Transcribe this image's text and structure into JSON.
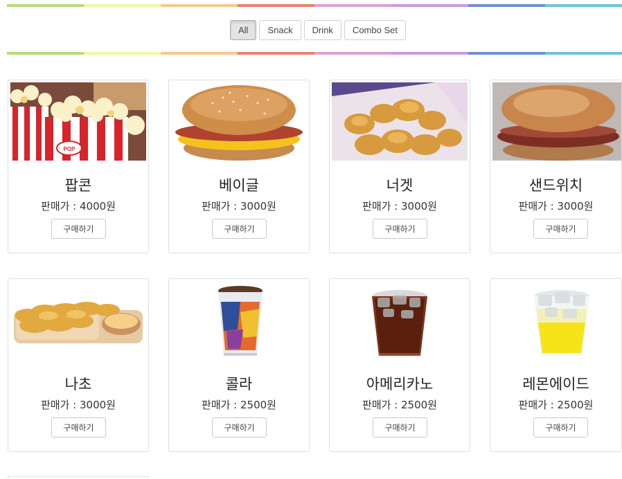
{
  "colors": {
    "rainbow": [
      "#b5dd7b",
      "#f1f7a6",
      "#f5c88a",
      "#e9826f",
      "#d9a4d0",
      "#c79be0",
      "#6f8fd6",
      "#6cc3dc"
    ]
  },
  "filters": [
    {
      "label": "All",
      "active": true
    },
    {
      "label": "Snack",
      "active": false
    },
    {
      "label": "Drink",
      "active": false
    },
    {
      "label": "Combo Set",
      "active": false
    }
  ],
  "products": [
    {
      "name": "팝콘",
      "price": "판매가 : 4000원",
      "buy_label": "구매하기",
      "image": "popcorn-image"
    },
    {
      "name": "베이글",
      "price": "판매가 : 3000원",
      "buy_label": "구매하기",
      "image": "bagel-sandwich-image"
    },
    {
      "name": "너겟",
      "price": "판매가 : 3000원",
      "buy_label": "구매하기",
      "image": "nuggets-image"
    },
    {
      "name": "샌드위치",
      "price": "판매가 : 3000원",
      "buy_label": "구매하기",
      "image": "sandwich-image"
    },
    {
      "name": "나초",
      "price": "판매가 : 3000원",
      "buy_label": "구매하기",
      "image": "nachos-image"
    },
    {
      "name": "콜라",
      "price": "판매가 : 2500원",
      "buy_label": "구매하기",
      "image": "cola-cup-image"
    },
    {
      "name": "아메리카노",
      "price": "판매가 : 2500원",
      "buy_label": "구매하기",
      "image": "iced-americano-image"
    },
    {
      "name": "레몬에이드",
      "price": "판매가 : 2500원",
      "buy_label": "구매하기",
      "image": "lemonade-image"
    }
  ]
}
